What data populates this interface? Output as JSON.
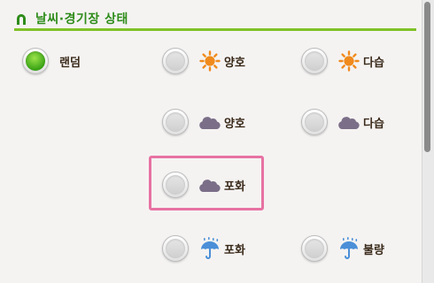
{
  "header": {
    "title": "날씨·경기장 상태",
    "icon": "horseshoe-icon"
  },
  "colors": {
    "accent_green": "#7fc128",
    "title_green": "#2e8c1a",
    "highlight_pink": "#e772a3"
  },
  "options": [
    {
      "id": "random",
      "label": "랜덤",
      "icon": "",
      "selected": true
    },
    {
      "id": "sunny-good",
      "label": "양호",
      "icon": "sun-icon",
      "selected": false
    },
    {
      "id": "sunny-damp",
      "label": "다습",
      "icon": "sun-icon",
      "selected": false
    },
    {
      "id": "cloudy-good",
      "label": "양호",
      "icon": "cloud-icon",
      "selected": false
    },
    {
      "id": "cloudy-damp",
      "label": "다습",
      "icon": "cloud-icon",
      "selected": false
    },
    {
      "id": "cloudy-saturated",
      "label": "포화",
      "icon": "cloud-icon",
      "selected": false,
      "highlighted": true
    },
    {
      "id": "rain-saturated",
      "label": "포화",
      "icon": "umbrella-icon",
      "selected": false
    },
    {
      "id": "rain-poor",
      "label": "불량",
      "icon": "umbrella-icon",
      "selected": false
    }
  ]
}
